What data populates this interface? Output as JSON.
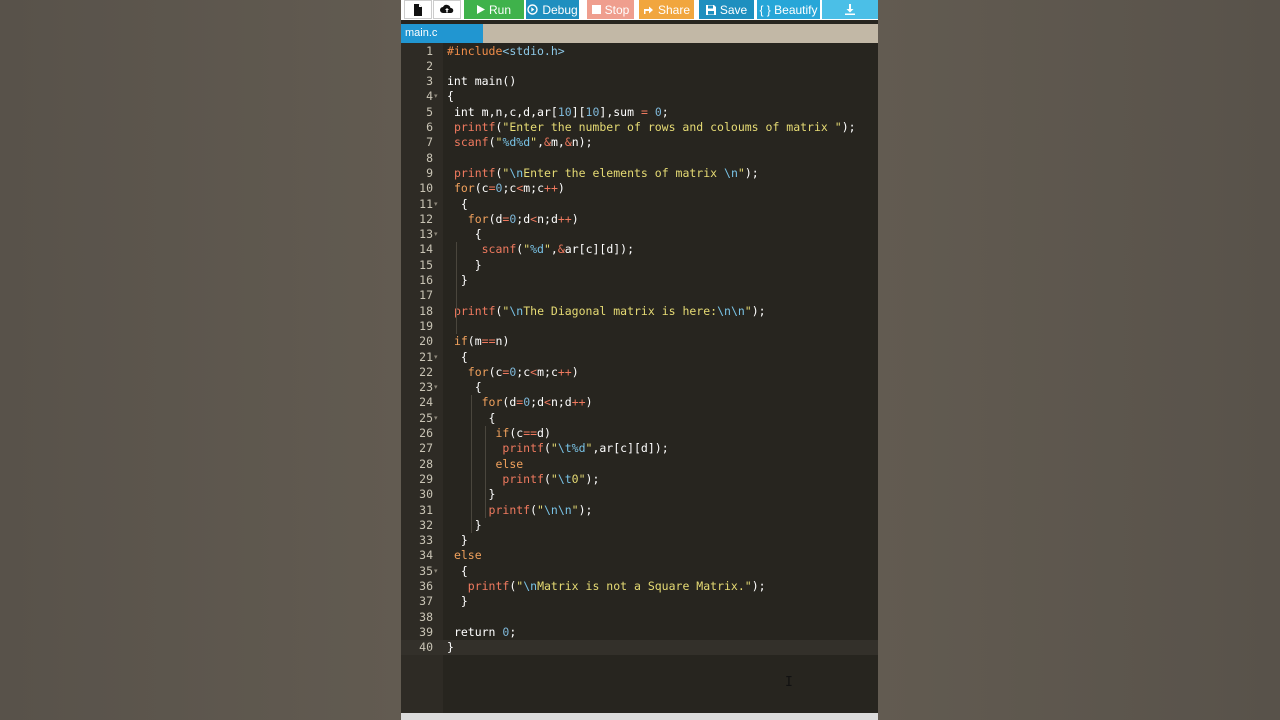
{
  "toolbar": {
    "new_file_icon": "file-icon",
    "upload_icon": "cloud-upload-icon",
    "run_label": "Run",
    "debug_label": "Debug",
    "stop_label": "Stop",
    "share_label": "Share",
    "save_label": "Save",
    "beautify_label": "{ } Beautify",
    "download_icon": "download-icon"
  },
  "tab": {
    "filename": "main.c"
  },
  "colors": {
    "run": "#3fb24b",
    "debug": "#1e8fbf",
    "stop": "#ef9e8e",
    "share": "#f1a63e",
    "save": "#1e8fbf",
    "beautify": "#27a6d8",
    "tab_active": "#2196d1",
    "editor_bg": "#27251f"
  },
  "editor": {
    "lines": [
      {
        "n": "1",
        "fold": false,
        "tokens": [
          [
            "pre",
            "#include"
          ],
          [
            "inc",
            "<stdio.h>"
          ]
        ]
      },
      {
        "n": "2",
        "fold": false,
        "tokens": []
      },
      {
        "n": "3",
        "fold": false,
        "tokens": [
          [
            "kw",
            "int"
          ],
          [
            "plain",
            " main()"
          ]
        ]
      },
      {
        "n": "4",
        "fold": true,
        "tokens": [
          [
            "plain",
            "{"
          ]
        ]
      },
      {
        "n": "5",
        "fold": false,
        "tokens": [
          [
            "plain",
            " "
          ],
          [
            "kw",
            "int"
          ],
          [
            "plain",
            " m,n,c,d,ar["
          ],
          [
            "num",
            "10"
          ],
          [
            "plain",
            "]["
          ],
          [
            "num",
            "10"
          ],
          [
            "plain",
            "],sum "
          ],
          [
            "op",
            "="
          ],
          [
            "plain",
            " "
          ],
          [
            "num",
            "0"
          ],
          [
            "plain",
            ";"
          ]
        ]
      },
      {
        "n": "6",
        "fold": false,
        "tokens": [
          [
            "plain",
            " "
          ],
          [
            "fn",
            "printf"
          ],
          [
            "plain",
            "("
          ],
          [
            "str",
            "\"Enter the number of rows and coloums of matrix \""
          ],
          [
            "plain",
            ");"
          ]
        ]
      },
      {
        "n": "7",
        "fold": false,
        "tokens": [
          [
            "plain",
            " "
          ],
          [
            "fn",
            "scanf"
          ],
          [
            "plain",
            "("
          ],
          [
            "str",
            "\""
          ],
          [
            "esc",
            "%d%d"
          ],
          [
            "str",
            "\""
          ],
          [
            "plain",
            ","
          ],
          [
            "op",
            "&"
          ],
          [
            "plain",
            "m,"
          ],
          [
            "op",
            "&"
          ],
          [
            "plain",
            "n);"
          ]
        ]
      },
      {
        "n": "8",
        "fold": false,
        "tokens": []
      },
      {
        "n": "9",
        "fold": false,
        "tokens": [
          [
            "plain",
            " "
          ],
          [
            "fn",
            "printf"
          ],
          [
            "plain",
            "("
          ],
          [
            "str",
            "\""
          ],
          [
            "esc",
            "\\n"
          ],
          [
            "str",
            "Enter the elements of matrix "
          ],
          [
            "esc",
            "\\n"
          ],
          [
            "str",
            "\""
          ],
          [
            "plain",
            ");"
          ]
        ]
      },
      {
        "n": "10",
        "fold": false,
        "tokens": [
          [
            "plain",
            " "
          ],
          [
            "ctrl",
            "for"
          ],
          [
            "plain",
            "(c"
          ],
          [
            "op",
            "="
          ],
          [
            "num",
            "0"
          ],
          [
            "plain",
            ";c"
          ],
          [
            "op",
            "<"
          ],
          [
            "plain",
            "m;c"
          ],
          [
            "op",
            "++"
          ],
          [
            "plain",
            ")"
          ]
        ]
      },
      {
        "n": "11",
        "fold": true,
        "tokens": [
          [
            "plain",
            "  {"
          ]
        ]
      },
      {
        "n": "12",
        "fold": false,
        "tokens": [
          [
            "plain",
            "   "
          ],
          [
            "ctrl",
            "for"
          ],
          [
            "plain",
            "(d"
          ],
          [
            "op",
            "="
          ],
          [
            "num",
            "0"
          ],
          [
            "plain",
            ";d"
          ],
          [
            "op",
            "<"
          ],
          [
            "plain",
            "n;d"
          ],
          [
            "op",
            "++"
          ],
          [
            "plain",
            ")"
          ]
        ]
      },
      {
        "n": "13",
        "fold": true,
        "tokens": [
          [
            "plain",
            "    {"
          ]
        ]
      },
      {
        "n": "14",
        "fold": false,
        "tokens": [
          [
            "plain",
            "     "
          ],
          [
            "fn",
            "scanf"
          ],
          [
            "plain",
            "("
          ],
          [
            "str",
            "\""
          ],
          [
            "esc",
            "%d"
          ],
          [
            "str",
            "\""
          ],
          [
            "plain",
            ","
          ],
          [
            "op",
            "&"
          ],
          [
            "plain",
            "ar[c][d]);"
          ]
        ]
      },
      {
        "n": "15",
        "fold": false,
        "tokens": [
          [
            "plain",
            "    }"
          ]
        ]
      },
      {
        "n": "16",
        "fold": false,
        "tokens": [
          [
            "plain",
            "  }"
          ]
        ]
      },
      {
        "n": "17",
        "fold": false,
        "tokens": []
      },
      {
        "n": "18",
        "fold": false,
        "tokens": [
          [
            "plain",
            " "
          ],
          [
            "fn",
            "printf"
          ],
          [
            "plain",
            "("
          ],
          [
            "str",
            "\""
          ],
          [
            "esc",
            "\\n"
          ],
          [
            "str",
            "The Diagonal matrix is here:"
          ],
          [
            "esc",
            "\\n\\n"
          ],
          [
            "str",
            "\""
          ],
          [
            "plain",
            ");"
          ]
        ]
      },
      {
        "n": "19",
        "fold": false,
        "tokens": []
      },
      {
        "n": "20",
        "fold": false,
        "tokens": [
          [
            "plain",
            " "
          ],
          [
            "ctrl",
            "if"
          ],
          [
            "plain",
            "(m"
          ],
          [
            "op",
            "=="
          ],
          [
            "plain",
            "n)"
          ]
        ]
      },
      {
        "n": "21",
        "fold": true,
        "tokens": [
          [
            "plain",
            "  {"
          ]
        ]
      },
      {
        "n": "22",
        "fold": false,
        "tokens": [
          [
            "plain",
            "   "
          ],
          [
            "ctrl",
            "for"
          ],
          [
            "plain",
            "(c"
          ],
          [
            "op",
            "="
          ],
          [
            "num",
            "0"
          ],
          [
            "plain",
            ";c"
          ],
          [
            "op",
            "<"
          ],
          [
            "plain",
            "m;c"
          ],
          [
            "op",
            "++"
          ],
          [
            "plain",
            ")"
          ]
        ]
      },
      {
        "n": "23",
        "fold": true,
        "tokens": [
          [
            "plain",
            "    {"
          ]
        ]
      },
      {
        "n": "24",
        "fold": false,
        "tokens": [
          [
            "plain",
            "     "
          ],
          [
            "ctrl",
            "for"
          ],
          [
            "plain",
            "(d"
          ],
          [
            "op",
            "="
          ],
          [
            "num",
            "0"
          ],
          [
            "plain",
            ";d"
          ],
          [
            "op",
            "<"
          ],
          [
            "plain",
            "n;d"
          ],
          [
            "op",
            "++"
          ],
          [
            "plain",
            ")"
          ]
        ]
      },
      {
        "n": "25",
        "fold": true,
        "tokens": [
          [
            "plain",
            "      {"
          ]
        ]
      },
      {
        "n": "26",
        "fold": false,
        "tokens": [
          [
            "plain",
            "       "
          ],
          [
            "ctrl",
            "if"
          ],
          [
            "plain",
            "(c"
          ],
          [
            "op",
            "=="
          ],
          [
            "plain",
            "d)"
          ]
        ]
      },
      {
        "n": "27",
        "fold": false,
        "tokens": [
          [
            "plain",
            "        "
          ],
          [
            "fn",
            "printf"
          ],
          [
            "plain",
            "("
          ],
          [
            "str",
            "\""
          ],
          [
            "esc",
            "\\t%d"
          ],
          [
            "str",
            "\""
          ],
          [
            "plain",
            ",ar[c][d]);"
          ]
        ]
      },
      {
        "n": "28",
        "fold": false,
        "tokens": [
          [
            "plain",
            "       "
          ],
          [
            "ctrl",
            "else"
          ]
        ]
      },
      {
        "n": "29",
        "fold": false,
        "tokens": [
          [
            "plain",
            "        "
          ],
          [
            "fn",
            "printf"
          ],
          [
            "plain",
            "("
          ],
          [
            "str",
            "\""
          ],
          [
            "esc",
            "\\t"
          ],
          [
            "str",
            "0\""
          ],
          [
            "plain",
            ");"
          ]
        ]
      },
      {
        "n": "30",
        "fold": false,
        "tokens": [
          [
            "plain",
            "      }"
          ]
        ]
      },
      {
        "n": "31",
        "fold": false,
        "tokens": [
          [
            "plain",
            "      "
          ],
          [
            "fn",
            "printf"
          ],
          [
            "plain",
            "("
          ],
          [
            "str",
            "\""
          ],
          [
            "esc",
            "\\n\\n"
          ],
          [
            "str",
            "\""
          ],
          [
            "plain",
            ");"
          ]
        ]
      },
      {
        "n": "32",
        "fold": false,
        "tokens": [
          [
            "plain",
            "    }"
          ]
        ]
      },
      {
        "n": "33",
        "fold": false,
        "tokens": [
          [
            "plain",
            "  }"
          ]
        ]
      },
      {
        "n": "34",
        "fold": false,
        "tokens": [
          [
            "plain",
            " "
          ],
          [
            "ctrl",
            "else"
          ]
        ]
      },
      {
        "n": "35",
        "fold": true,
        "tokens": [
          [
            "plain",
            "  {"
          ]
        ]
      },
      {
        "n": "36",
        "fold": false,
        "tokens": [
          [
            "plain",
            "   "
          ],
          [
            "fn",
            "printf"
          ],
          [
            "plain",
            "("
          ],
          [
            "str",
            "\""
          ],
          [
            "esc",
            "\\n"
          ],
          [
            "str",
            "Matrix is not a Square Matrix.\""
          ],
          [
            "plain",
            ");"
          ]
        ]
      },
      {
        "n": "37",
        "fold": false,
        "tokens": [
          [
            "plain",
            "  }"
          ]
        ]
      },
      {
        "n": "38",
        "fold": false,
        "tokens": []
      },
      {
        "n": "39",
        "fold": false,
        "tokens": [
          [
            "plain",
            " "
          ],
          [
            "kw",
            "return"
          ],
          [
            "plain",
            " "
          ],
          [
            "num",
            "0"
          ],
          [
            "plain",
            ";"
          ]
        ]
      },
      {
        "n": "40",
        "fold": false,
        "active": true,
        "tokens": [
          [
            "plain",
            "}"
          ]
        ]
      }
    ]
  }
}
